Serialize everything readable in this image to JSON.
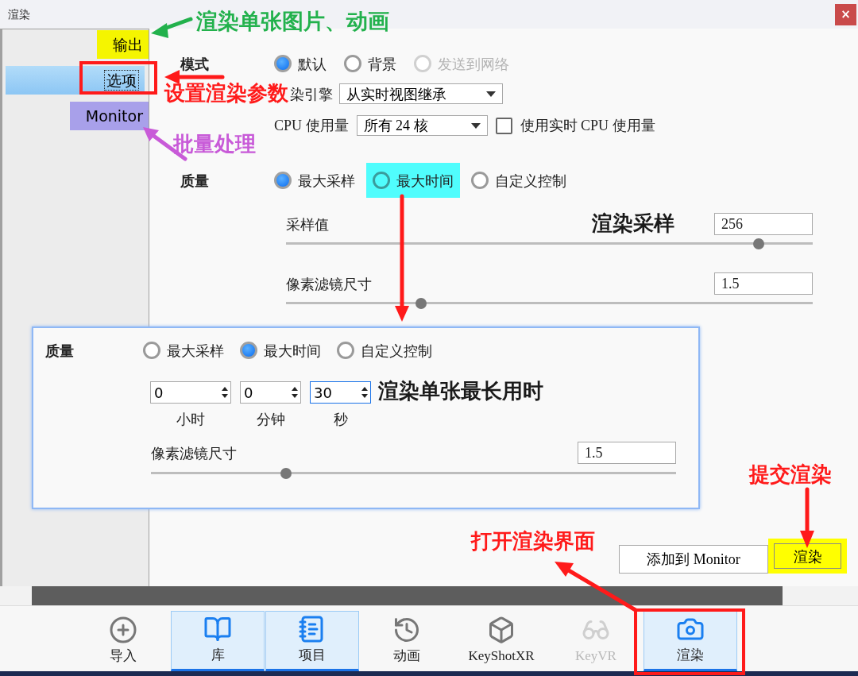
{
  "window": {
    "title": "渲染",
    "close": "×"
  },
  "sidebar": {
    "items": [
      {
        "label": "输出",
        "selected": false,
        "color": "#f5f500"
      },
      {
        "label": "选项",
        "selected": true
      },
      {
        "label": "Monitor",
        "selected": false,
        "color": "#a8a0ea"
      }
    ]
  },
  "mode": {
    "label": "模式",
    "options": [
      {
        "label": "默认",
        "selected": true,
        "disabled": false
      },
      {
        "label": "背景",
        "selected": false,
        "disabled": false
      },
      {
        "label": "发送到网络",
        "selected": false,
        "disabled": true
      }
    ]
  },
  "engine": {
    "label": "染引擎",
    "value": "从实时视图继承"
  },
  "cpu": {
    "label": "CPU 使用量",
    "value": "所有 24 核",
    "realtime": {
      "label": "使用实时 CPU 使用量",
      "checked": false
    }
  },
  "quality": {
    "label": "质量",
    "options": [
      {
        "label": "最大采样",
        "selected": true,
        "highlighted": false
      },
      {
        "label": "最大时间",
        "selected": false,
        "highlighted": true
      },
      {
        "label": "自定义控制",
        "selected": false,
        "highlighted": false
      }
    ]
  },
  "samples": {
    "label": "采样值",
    "value": "256",
    "level": 0.897
  },
  "pixel_filter": {
    "label": "像素滤镜尺寸",
    "value": "1.5",
    "level": 0.257
  },
  "inset": {
    "label": "质量",
    "options": [
      {
        "label": "最大采样",
        "selected": false
      },
      {
        "label": "最大时间",
        "selected": true
      },
      {
        "label": "自定义控制",
        "selected": false
      }
    ],
    "time": [
      {
        "value": "0",
        "unit": "小时",
        "focused": false
      },
      {
        "value": "0",
        "unit": "分钟",
        "focused": false
      },
      {
        "value": "30",
        "unit": "秒",
        "focused": true
      }
    ],
    "pixel_filter": {
      "label": "像素滤镜尺寸",
      "value": "1.5",
      "level": 0.257
    }
  },
  "buttons": [
    {
      "label": "添加到 Monitor",
      "highlighted": false
    },
    {
      "label": "渲染",
      "highlighted": true
    }
  ],
  "toolbar": [
    {
      "label": "导入",
      "kind": "import",
      "selected": false,
      "disabled": false
    },
    {
      "label": "库",
      "kind": "library",
      "selected": true,
      "disabled": false
    },
    {
      "label": "项目",
      "kind": "project",
      "selected": true,
      "disabled": false
    },
    {
      "label": "动画",
      "kind": "animation",
      "selected": false,
      "disabled": false
    },
    {
      "label": "KeyShotXR",
      "kind": "xr",
      "selected": false,
      "disabled": false
    },
    {
      "label": "KeyVR",
      "kind": "vr",
      "selected": false,
      "disabled": true
    },
    {
      "label": "渲染",
      "kind": "render",
      "selected": true,
      "disabled": false
    }
  ],
  "annotations": [
    {
      "text": "渲染单张图片、动画",
      "color": "#22b14c"
    },
    {
      "text": "设置渲染参数",
      "color": "#ff1a1a"
    },
    {
      "text": "批量处理",
      "color": "#c85ad8"
    },
    {
      "text": "渲染采样",
      "color": "#1a1a1a"
    },
    {
      "text": "渲染单张最长用时",
      "color": "#1a1a1a"
    },
    {
      "text": "提交渲染",
      "color": "#ff1a1a"
    },
    {
      "text": "打开渲染界面",
      "color": "#ff1a1a"
    }
  ]
}
